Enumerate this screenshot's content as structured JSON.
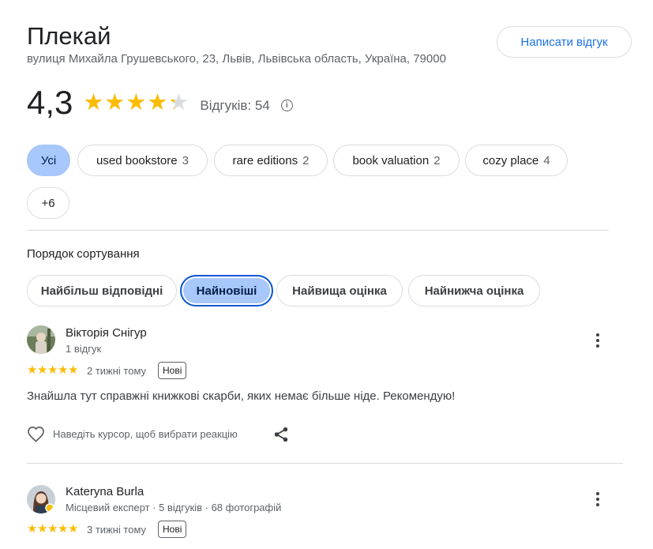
{
  "place": {
    "title": "Плекай",
    "address": "вулиця Михайла Грушевського, 23, Львів, Львівська область, Україна, 79000",
    "write_review_label": "Написати відгук"
  },
  "rating": {
    "value_text": "4,3",
    "value": 4.3,
    "reviews_label": "Відгуків: 54",
    "info_icon": "info-icon"
  },
  "filters": [
    {
      "label": "Усі",
      "count": "",
      "active": true
    },
    {
      "label": "used bookstore",
      "count": "3",
      "active": false
    },
    {
      "label": "rare editions",
      "count": "2",
      "active": false
    },
    {
      "label": "book valuation",
      "count": "2",
      "active": false
    },
    {
      "label": "cozy place",
      "count": "4",
      "active": false
    },
    {
      "label": "+6",
      "count": "",
      "active": false
    }
  ],
  "sort": {
    "label": "Порядок сортування",
    "options": [
      {
        "label": "Найбільш відповідні",
        "active": false
      },
      {
        "label": "Найновіші",
        "active": true
      },
      {
        "label": "Найвища оцінка",
        "active": false
      },
      {
        "label": "Найнижча оцінка",
        "active": false
      }
    ]
  },
  "reviews": [
    {
      "author": "Вікторія Снігур",
      "meta": "1 відгук",
      "stars": 5,
      "time": "2 тижні тому",
      "badge": "Нові",
      "text": "Знайшла тут справжні книжкові скарби, яких немає більше ніде. Рекомендую!",
      "reaction_hint": "Наведіть курсор, щоб вибрати реакцію"
    },
    {
      "author": "Kateryna Burla",
      "meta": "Місцевий експерт · 5 відгуків · 68 фотографій",
      "stars": 5,
      "time": "3 тижні тому",
      "badge": "Нові"
    }
  ],
  "colors": {
    "accent": "#1a73e8",
    "star": "#fbbc04",
    "chip_active": "#a8c7fa",
    "chip_active_border": "#0b57d0"
  }
}
